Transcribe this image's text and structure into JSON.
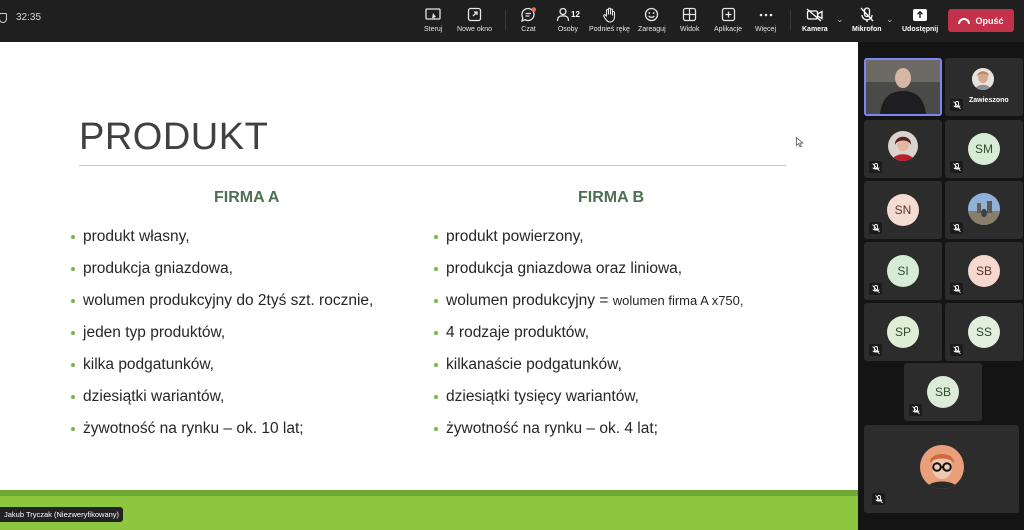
{
  "topbar": {
    "timer": "32:35",
    "buttons": {
      "steruj": "Steruj",
      "nowe_okno": "Nowe okno",
      "czat": "Czat",
      "osoby": "Osoby",
      "osoby_count": "12",
      "podnies_reke": "Podnieś rękę",
      "zareaguj": "Zareaguj",
      "widok": "Widok",
      "aplikacje": "Aplikacje",
      "wiecej": "Więcej",
      "kamera": "Kamera",
      "mikrofon": "Mikrofon",
      "udostepnij": "Udostępnij"
    },
    "leave_label": "Opuść",
    "leave_color": "#c4314b"
  },
  "slide": {
    "title": "PRODUKT",
    "firma_a": {
      "heading": "FIRMA A",
      "items": [
        "produkt własny,",
        "produkcja gniazdowa,",
        "wolumen produkcyjny do 2tyś szt. rocznie,",
        "jeden typ produktów,",
        "kilka podgatunków,",
        "dziesiątki wariantów,",
        "żywotność na rynku – ok. 10 lat;"
      ]
    },
    "firma_b": {
      "heading": "FIRMA B",
      "items": [
        "produkt powierzony,",
        "produkcja gniazdowa oraz liniowa,",
        "wolumen produkcyjny = ",
        "4 rodzaje produktów,",
        "kilkanaście podgatunków,",
        "dziesiątki tysięcy wariantów,",
        "żywotność na rynku – ok. 4 lat;"
      ],
      "volume_suffix": "wolumen firma A x750,"
    },
    "accent_color": "#8dc63f",
    "heading_color": "#4e6f53"
  },
  "presenter_label": "Jakub Tryczak (Niezweryfikowany)",
  "participants": {
    "paused_label": "Zawieszono",
    "initials": {
      "sm": "SM",
      "sn": "SN",
      "si": "SI",
      "sb1": "SB",
      "sp": "SP",
      "ss": "SS",
      "sb2": "SB"
    }
  }
}
